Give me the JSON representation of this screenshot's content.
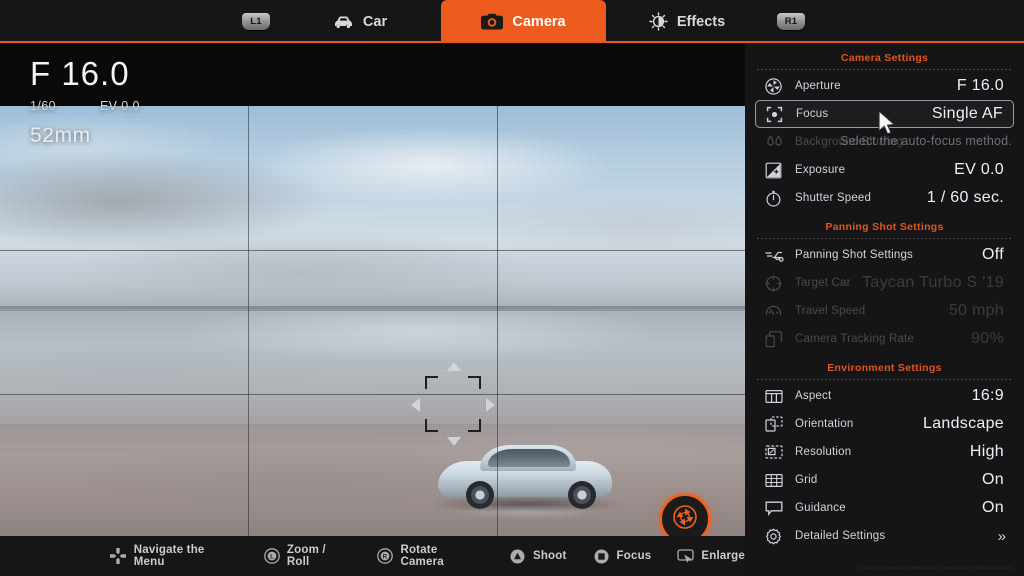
{
  "topnav": {
    "left_shoulder": "L1",
    "right_shoulder": "R1",
    "tabs": [
      {
        "label": "Car",
        "icon": "car-icon",
        "active": false
      },
      {
        "label": "Camera",
        "icon": "camera-icon",
        "active": true
      },
      {
        "label": "Effects",
        "icon": "brightness-icon",
        "active": false
      }
    ]
  },
  "viewfinder": {
    "aperture": "F 16.0",
    "shutter": "1/60",
    "exposure": "EV 0.0",
    "focal_length": "52mm",
    "shoot_label": "Shoot",
    "shutter_icon": "aperture-icon",
    "grid_visible": true,
    "focus_reticle": "focus-reticle"
  },
  "footer_hints": [
    {
      "label": "Navigate the Menu",
      "icon": "dpad-icon"
    },
    {
      "label": "Zoom / Roll",
      "icon": "left-stick-icon"
    },
    {
      "label": "Rotate Camera",
      "icon": "right-stick-icon"
    },
    {
      "label": "Shoot",
      "icon": "triangle-button-icon"
    },
    {
      "label": "Focus",
      "icon": "square-button-icon"
    },
    {
      "label": "Enlarge",
      "icon": "touchpad-icon"
    }
  ],
  "sidebar": {
    "tooltip": "Select the auto-focus method.",
    "detailed_chevron": "»",
    "sections": [
      {
        "title": "Camera Settings",
        "rows": [
          {
            "label": "Aperture",
            "value": "F 16.0",
            "icon": "aperture-icon",
            "state": "normal"
          },
          {
            "label": "Focus",
            "value": "Single AF",
            "icon": "focus-bracket-icon",
            "state": "selected"
          },
          {
            "label": "Background Blurring",
            "value": "",
            "icon": "bokeh-icon",
            "state": "disabled"
          },
          {
            "label": "Exposure",
            "value": "EV 0.0",
            "icon": "exposure-icon",
            "state": "normal"
          },
          {
            "label": "Shutter Speed",
            "value": "1 / 60 sec.",
            "icon": "stopwatch-icon",
            "state": "normal"
          }
        ]
      },
      {
        "title": "Panning Shot Settings",
        "rows": [
          {
            "label": "Panning Shot Settings",
            "value": "Off",
            "icon": "panning-icon",
            "state": "normal"
          },
          {
            "label": "Target Car",
            "value": "Taycan Turbo S '19",
            "icon": "target-icon",
            "state": "disabled"
          },
          {
            "label": "Travel Speed",
            "value": "50 mph",
            "icon": "speedometer-icon",
            "state": "disabled"
          },
          {
            "label": "Camera Tracking Rate",
            "value": "90%",
            "icon": "tracking-icon",
            "state": "disabled"
          }
        ]
      },
      {
        "title": "Environment Settings",
        "rows": [
          {
            "label": "Aspect",
            "value": "16:9",
            "icon": "aspect-icon",
            "state": "normal"
          },
          {
            "label": "Orientation",
            "value": "Landscape",
            "icon": "orientation-icon",
            "state": "normal"
          },
          {
            "label": "Resolution",
            "value": "High",
            "icon": "resolution-icon",
            "state": "normal"
          },
          {
            "label": "Grid",
            "value": "On",
            "icon": "grid-icon",
            "state": "normal"
          },
          {
            "label": "Guidance",
            "value": "On",
            "icon": "speech-bubble-icon",
            "state": "normal"
          },
          {
            "label": "Detailed Settings",
            "value": "",
            "icon": "gear-icon",
            "state": "chevron"
          }
        ]
      }
    ]
  },
  "copyright": "© 2023 Sony Interactive Entertainment Inc. Developed by Polyphony Digital Inc.",
  "colors": {
    "accent": "#ee5b1e",
    "section_header": "#e2551d",
    "panel_bg": "#151517"
  }
}
